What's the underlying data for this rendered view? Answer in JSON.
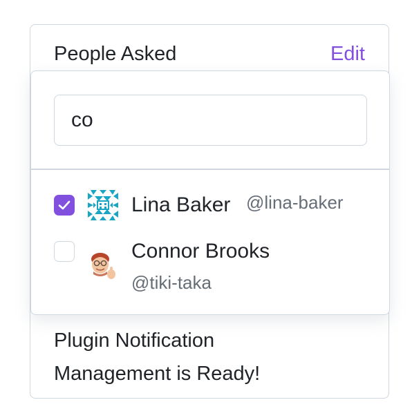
{
  "card": {
    "title": "People Asked",
    "edit_label": "Edit",
    "body_line1": "Plugin Notification",
    "body_line2": "Management is Ready!"
  },
  "popover": {
    "search_value": "co",
    "users": [
      {
        "name": "Lina Baker",
        "handle": "@lina-baker",
        "checked": true,
        "avatar": "geometric-identicon"
      },
      {
        "name": "Connor Brooks",
        "handle": "@tiki-taka",
        "checked": false,
        "avatar": "memoji-thumbs-up"
      }
    ]
  },
  "colors": {
    "accent": "#8250df",
    "border": "#d0d7de",
    "muted_text": "#656d76",
    "identicon": "#1ba5c5"
  }
}
